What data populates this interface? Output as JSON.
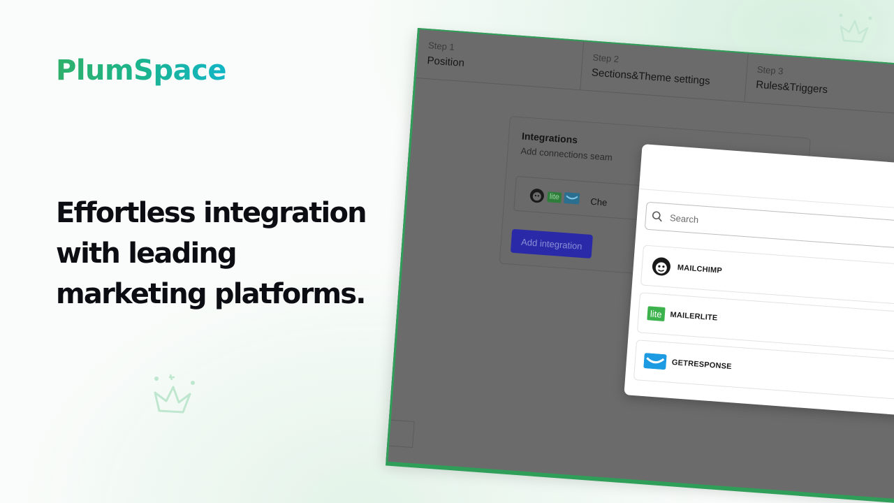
{
  "brand": {
    "name": "PlumSpace",
    "accent": "#1cb48a"
  },
  "headline": {
    "lines": [
      "Effortless integration",
      "with leading",
      "marketing platforms."
    ]
  },
  "app": {
    "steps": [
      {
        "num": "Step 1",
        "title": "Position"
      },
      {
        "num": "Step 2",
        "title": "Sections&Theme settings"
      },
      {
        "num": "Step 3",
        "title": "Rules&Triggers"
      }
    ],
    "integrations": {
      "title": "Integrations",
      "subtitle": "Add connections seam",
      "row_text": "Che",
      "lite_label": "lite",
      "add_button": "Add integration"
    },
    "modal": {
      "search_placeholder": "Search",
      "platforms": [
        {
          "name": "MAILCHIMP",
          "icon": "mailchimp-icon"
        },
        {
          "name": "MAILERLITE",
          "icon": "mailerlite-icon",
          "badge": "lite"
        },
        {
          "name": "GETRESPONSE",
          "icon": "getresponse-icon"
        }
      ],
      "connect_color": "#1db46a"
    }
  }
}
